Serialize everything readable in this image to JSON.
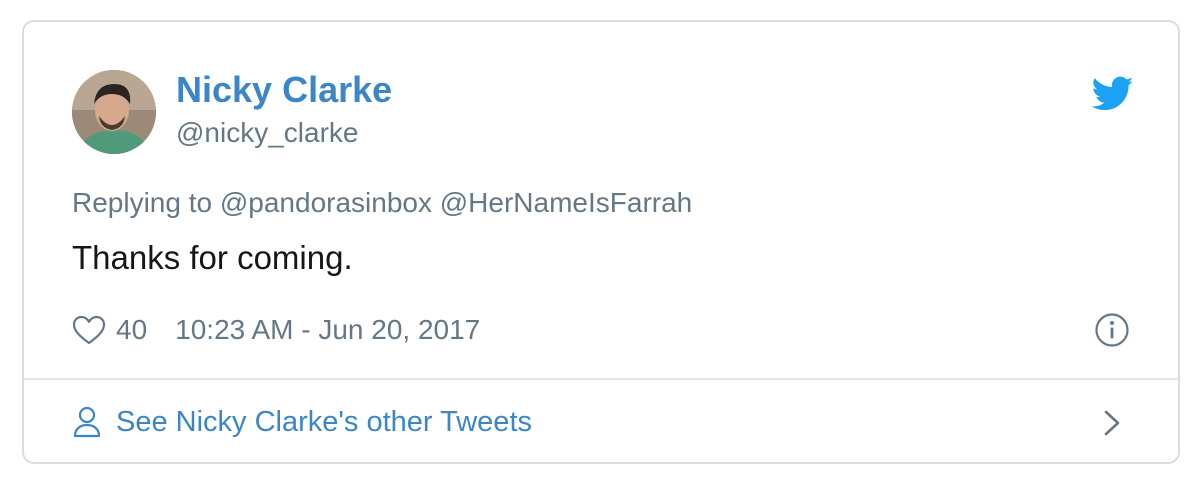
{
  "tweet": {
    "author_name": "Nicky Clarke",
    "author_handle": "@nicky_clarke",
    "replying_to": "Replying to @pandorasinbox @HerNameIsFarrah",
    "text": "Thanks for coming.",
    "like_count": "40",
    "timestamp": "10:23 AM - Jun 20, 2017"
  },
  "footer": {
    "link_label": "See Nicky Clarke's other Tweets"
  },
  "icons": {
    "brand": "twitter-bird-icon",
    "like": "heart-icon",
    "info": "info-icon",
    "profile": "person-icon",
    "forward": "chevron-right-icon"
  },
  "colors": {
    "link": "#3b86c7",
    "twitter_blue": "#1da1f2",
    "muted": "#657786",
    "text": "#14171a",
    "border": "#d8dde2"
  }
}
